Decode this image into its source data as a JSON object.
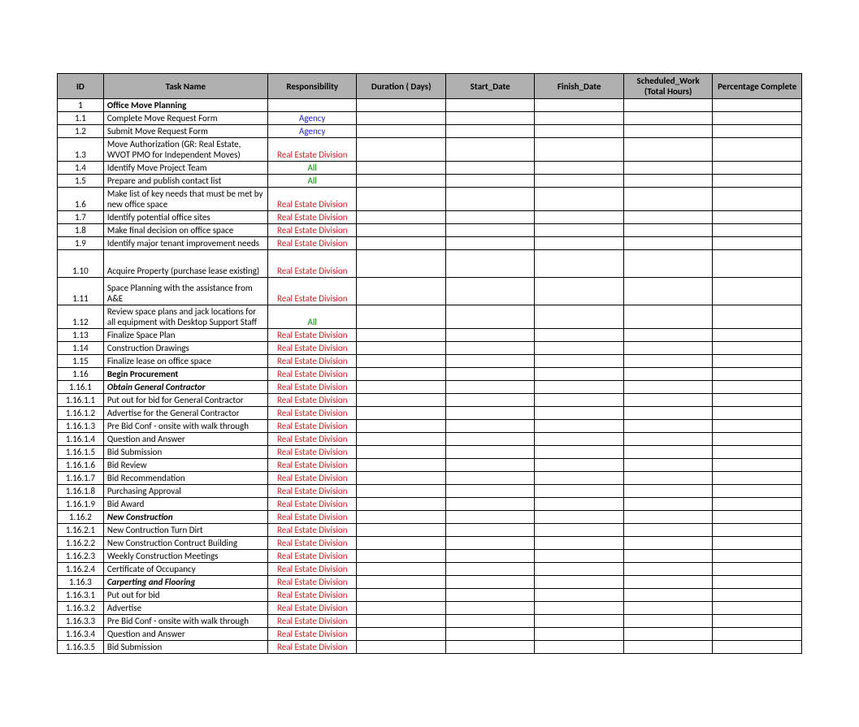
{
  "headers": {
    "id": "ID",
    "task": "Task Name",
    "resp": "Responsibility",
    "dur": "Duration ( Days)",
    "start": "Start_Date",
    "finish": "Finish_Date",
    "hours": "Scheduled_Work (Total Hours)",
    "pct": "Percentage Complete"
  },
  "responsibilities": {
    "Agency": "Agency",
    "All": "All",
    "RealEstate": "Real Estate Division"
  },
  "rows": [
    {
      "id": "1",
      "task": "Office Move Planning",
      "resp": "",
      "bold": true
    },
    {
      "id": "1.1",
      "task": "Complete Move Request Form",
      "resp": "Agency"
    },
    {
      "id": "1.2",
      "task": "Submit Move Request Form",
      "resp": "Agency"
    },
    {
      "id": "1.3",
      "task": "Move Authorization (GR: Real Estate, WVOT PMO for Independent Moves)",
      "resp": "RealEstate",
      "tall": true
    },
    {
      "id": "1.4",
      "task": "Identify Move Project Team",
      "resp": "All"
    },
    {
      "id": "1.5",
      "task": "Prepare and publish contact list",
      "resp": "All"
    },
    {
      "id": "1.6",
      "task": "Make list of key needs that must be met by new office space",
      "resp": "RealEstate",
      "tall": true
    },
    {
      "id": "1.7",
      "task": "Identify potential office sites",
      "resp": "RealEstate"
    },
    {
      "id": "1.8",
      "task": "Make final decision on office space",
      "resp": "RealEstate"
    },
    {
      "id": "1.9",
      "task": "Identify major tenant improvement needs",
      "resp": "RealEstate"
    },
    {
      "id": "1.10",
      "task": "Acquire Property (purchase lease existing)",
      "resp": "RealEstate",
      "taller": true
    },
    {
      "id": "1.11",
      "task": "Space Planning with the assistance from A&E",
      "resp": "RealEstate",
      "taller": true
    },
    {
      "id": "1.12",
      "task": "Review space plans and jack locations for all equipment with Desktop Support Staff",
      "resp": "All",
      "tall": true
    },
    {
      "id": "1.13",
      "task": "Finalize Space Plan",
      "resp": "RealEstate"
    },
    {
      "id": "1.14",
      "task": "Construction Drawings",
      "resp": "RealEstate"
    },
    {
      "id": "1.15",
      "task": "Finalize lease on office space",
      "resp": "RealEstate"
    },
    {
      "id": "1.16",
      "task": "Begin Procurement",
      "resp": "RealEstate",
      "bold": true
    },
    {
      "id": "1.16.1",
      "task": "Obtain General Contractor",
      "resp": "RealEstate",
      "bold": true,
      "italic": true
    },
    {
      "id": "1.16.1.1",
      "task": "Put out for bid for General Contractor",
      "resp": "RealEstate"
    },
    {
      "id": "1.16.1.2",
      "task": "Advertise for the General Contractor",
      "resp": "RealEstate"
    },
    {
      "id": "1.16.1.3",
      "task": "Pre Bid Conf - onsite with walk through",
      "resp": "RealEstate"
    },
    {
      "id": "1.16.1.4",
      "task": "Question and Answer",
      "resp": "RealEstate"
    },
    {
      "id": "1.16.1.5",
      "task": "Bid Submission",
      "resp": "RealEstate"
    },
    {
      "id": "1.16.1.6",
      "task": "Bid Review",
      "resp": "RealEstate"
    },
    {
      "id": "1.16.1.7",
      "task": "Bid Recommendation",
      "resp": "RealEstate"
    },
    {
      "id": "1.16.1.8",
      "task": "Purchasing Approval",
      "resp": "RealEstate"
    },
    {
      "id": "1.16.1.9",
      "task": "Bid Award",
      "resp": "RealEstate"
    },
    {
      "id": "1.16.2",
      "task": "New Construction",
      "resp": "RealEstate",
      "bold": true,
      "italic": true
    },
    {
      "id": "1.16.2.1",
      "task": "New Contruction Turn Dirt",
      "resp": "RealEstate"
    },
    {
      "id": "1.16.2.2",
      "task": "New Construction Contruct Building",
      "resp": "RealEstate"
    },
    {
      "id": "1.16.2.3",
      "task": "Weekly Construction Meetings",
      "resp": "RealEstate"
    },
    {
      "id": "1.16.2.4",
      "task": "Certificate of Occupancy",
      "resp": "RealEstate"
    },
    {
      "id": "1.16.3",
      "task": "Carperting and Flooring",
      "resp": "RealEstate",
      "bold": true,
      "italic": true
    },
    {
      "id": "1.16.3.1",
      "task": "Put out for bid",
      "resp": "RealEstate"
    },
    {
      "id": "1.16.3.2",
      "task": "Advertise",
      "resp": "RealEstate"
    },
    {
      "id": "1.16.3.3",
      "task": "Pre Bid Conf - onsite with walk through",
      "resp": "RealEstate"
    },
    {
      "id": "1.16.3.4",
      "task": "Question and Answer",
      "resp": "RealEstate"
    },
    {
      "id": "1.16.3.5",
      "task": "Bid Submission",
      "resp": "RealEstate"
    }
  ]
}
